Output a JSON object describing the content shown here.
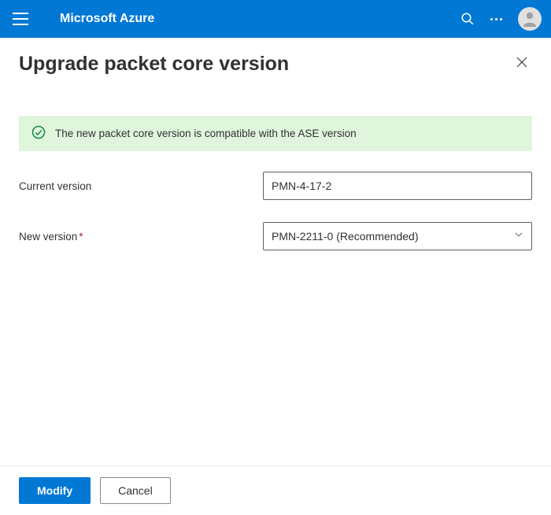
{
  "header": {
    "brand": "Microsoft Azure"
  },
  "page": {
    "title": "Upgrade packet core version"
  },
  "banner": {
    "message": "The new packet core version is compatible with the ASE version"
  },
  "form": {
    "current_version_label": "Current version",
    "current_version_value": "PMN-4-17-2",
    "new_version_label": "New version",
    "new_version_value": "PMN-2211-0 (Recommended)"
  },
  "footer": {
    "primary_label": "Modify",
    "secondary_label": "Cancel"
  }
}
